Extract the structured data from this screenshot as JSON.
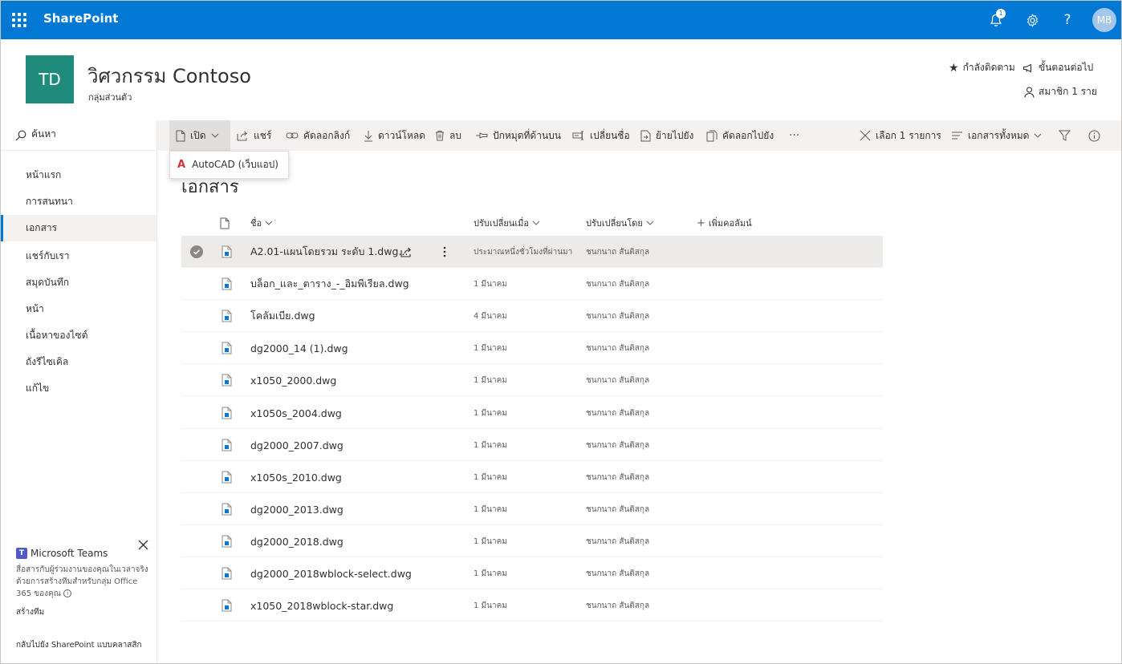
{
  "suite": {
    "brand": "SharePoint",
    "notification_count": "1",
    "avatar_initials": "MB"
  },
  "site": {
    "logo": "TD",
    "title": "วิศวกรรม Contoso",
    "subtitle": "กลุ่มส่วนตัว",
    "following": "กำลังติดตาม",
    "next_steps": "ขั้นตอนต่อไป",
    "members": "สมาชิก 1 ราย"
  },
  "search": {
    "placeholder": "ค้นหา"
  },
  "toolbar": {
    "open": "เปิด",
    "share": "แชร์",
    "copy_link": "คัดลอกลิงก์",
    "download": "ดาวน์โหลด",
    "delete": "ลบ",
    "pin": "ปักหมุดที่ด้านบน",
    "rename": "เปลี่ยนชื่อ",
    "move_to": "ย้ายไปยัง",
    "copy_to": "คัดลอกไปยัง",
    "more": "···",
    "selected": "เลือก 1 รายการ",
    "view": "เอกสารทั้งหมด"
  },
  "open_menu": {
    "item": "AutoCAD (เว็บแอป)"
  },
  "nav": {
    "items": [
      "หน้าแรก",
      "การสนทนา",
      "เอกสาร",
      "แชร์กับเรา",
      "สมุดบันทึก",
      "หน้า",
      "เนื้อหาของไซต์",
      "ถังรีไซเคิล",
      "แก้ไข"
    ],
    "selected_index": 2,
    "teams_title": "Microsoft Teams",
    "teams_desc": "สื่อสารกับผู้ร่วมงานของคุณในเวลาจริงด้วยการสร้างทีมสำหรับกลุ่ม Office 365 ของคุณ",
    "teams_link": "สร้างทีม",
    "classic": "กลับไปยัง SharePoint แบบคลาสสิก"
  },
  "library": {
    "title": "เอกสาร",
    "columns": {
      "name": "ชื่อ",
      "modified": "ปรับเปลี่ยนเมื่อ",
      "modified_by": "ปรับเปลี่ยนโดย",
      "add_column": "เพิ่มคอลัมน์"
    },
    "rows": [
      {
        "name": "A2.01-แผนโดยรวม ระดับ 1.dwg...",
        "modified": "ประมาณหนึ่งชั่วโมงที่ผ่านมา",
        "by": "ชนกนาถ สันติสกุล",
        "selected": true
      },
      {
        "name": "บล็อก_และ_ตาราง_-_อิมพีเรียล.dwg",
        "modified": "1 มีนาคม",
        "by": "ชนกนาถ สันติสกุล"
      },
      {
        "name": "โคลัมเบีย.dwg",
        "modified": "4 มีนาคม",
        "by": "ชนกนาถ สันติสกุล"
      },
      {
        "name": "dg2000_14 (1).dwg",
        "modified": "1 มีนาคม",
        "by": "ชนกนาถ สันติสกุล"
      },
      {
        "name": "x1050_2000.dwg",
        "modified": "1 มีนาคม",
        "by": "ชนกนาถ สันติสกุล"
      },
      {
        "name": "x1050s_2004.dwg",
        "modified": "1 มีนาคม",
        "by": "ชนกนาถ สันติสกุล"
      },
      {
        "name": "dg2000_2007.dwg",
        "modified": "1 มีนาคม",
        "by": "ชนกนาถ สันติสกุล"
      },
      {
        "name": "x1050s_2010.dwg",
        "modified": "1 มีนาคม",
        "by": "ชนกนาถ สันติสกุล"
      },
      {
        "name": "dg2000_2013.dwg",
        "modified": "1 มีนาคม",
        "by": "ชนกนาถ สันติสกุล"
      },
      {
        "name": "dg2000_2018.dwg",
        "modified": "1 มีนาคม",
        "by": "ชนกนาถ สันติสกุล"
      },
      {
        "name": "dg2000_2018wblock-select.dwg",
        "modified": "1 มีนาคม",
        "by": "ชนกนาถ สันติสกุล"
      },
      {
        "name": "x1050_2018wblock-star.dwg",
        "modified": "1 มีนาคม",
        "by": "ชนกนาถ สันติสกุล"
      }
    ]
  },
  "colors": {
    "suite_bar": "#0078d4",
    "site_logo": "#1e8b7c",
    "autocad_red": "#d13438"
  }
}
